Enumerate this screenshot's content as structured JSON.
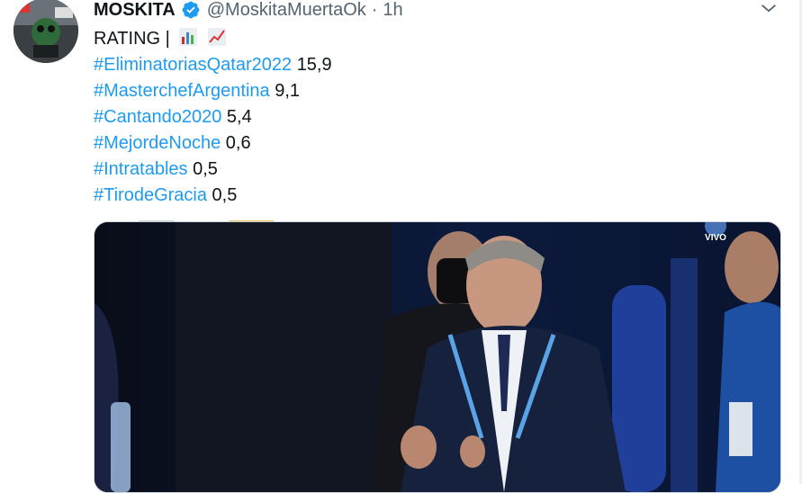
{
  "tweet": {
    "display_name": "MOSKITA",
    "handle": "@MoskitaMuertaOk",
    "separator": "·",
    "time": "1h",
    "lines": [
      {
        "pre": "RATING |",
        "emojis": [
          "bar-chart-icon",
          "chart-increasing-icon"
        ]
      },
      {
        "hashtag": "#EliminatoriasQatar2022",
        "value": "15,9"
      },
      {
        "hashtag": "#MasterchefArgentina",
        "value": "9,1"
      },
      {
        "hashtag": "#Cantando2020",
        "value": "5,4"
      },
      {
        "hashtag": "#MejordeNoche",
        "value": "0,6"
      },
      {
        "hashtag": "#Intratables",
        "value": "0,5"
      },
      {
        "hashtag": "#TirodeGracia",
        "value": "0,5"
      }
    ],
    "media": {
      "overlay_label": "VIVO"
    }
  },
  "colors": {
    "link": "#1d9bf0",
    "text": "#0f1419",
    "secondary": "#536471",
    "verified": "#1d9bf0"
  }
}
